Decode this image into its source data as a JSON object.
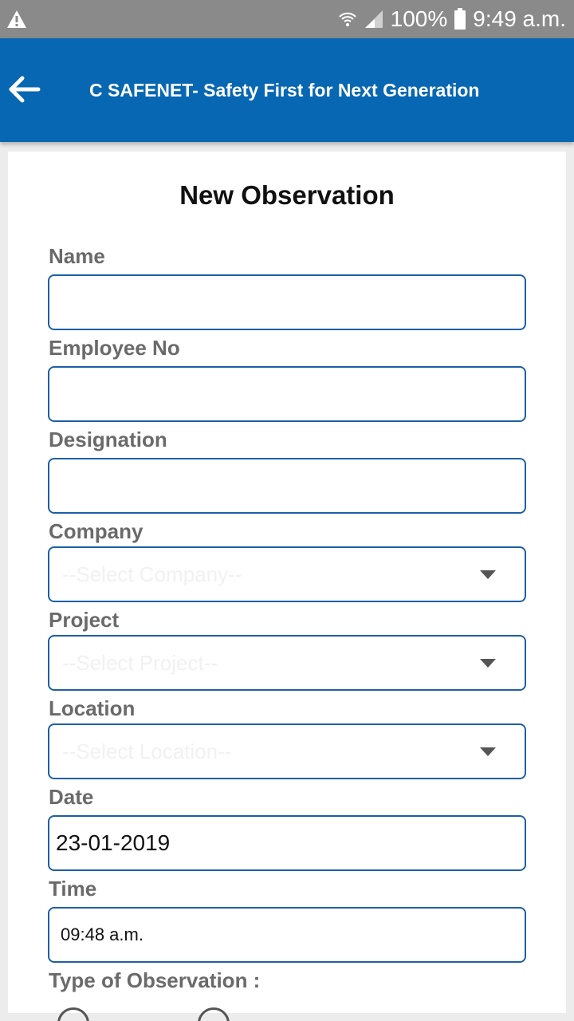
{
  "status_bar": {
    "battery": "100%",
    "time": "9:49 a.m.",
    "icons": [
      "warning-icon",
      "wifi-icon",
      "signal-icon",
      "battery-icon"
    ]
  },
  "app_bar": {
    "title": "C SAFENET- Safety First for Next Generation",
    "back_icon": "arrow-left-icon",
    "color": "#0767b2"
  },
  "form": {
    "title": "New Observation",
    "name_label": "Name",
    "name_value": "",
    "employee_no_label": "Employee No",
    "employee_no_value": "",
    "designation_label": "Designation",
    "designation_value": "",
    "company_label": "Company",
    "company_placeholder": "--Select Company--",
    "project_label": "Project",
    "project_placeholder": "--Select Project--",
    "location_label": "Location",
    "location_placeholder": "--Select Location--",
    "date_label": "Date",
    "date_value": "23-01-2019",
    "time_label": "Time",
    "time_value": "09:48 a.m.",
    "type_label": "Type of Observation :"
  },
  "colors": {
    "field_border": "#1d5fa6",
    "label": "#6a6a6a",
    "status_bar": "#8a8a8a"
  }
}
